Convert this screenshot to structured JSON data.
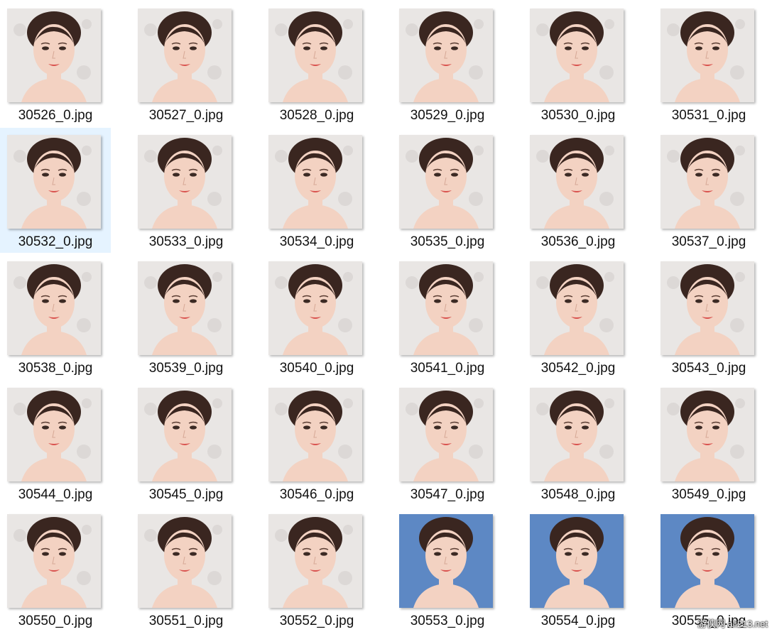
{
  "files": [
    {
      "name": "30526_0.jpg",
      "bg": "light",
      "selected": false
    },
    {
      "name": "30527_0.jpg",
      "bg": "light",
      "selected": false
    },
    {
      "name": "30528_0.jpg",
      "bg": "light",
      "selected": false
    },
    {
      "name": "30529_0.jpg",
      "bg": "light",
      "selected": false
    },
    {
      "name": "30530_0.jpg",
      "bg": "light",
      "selected": false
    },
    {
      "name": "30531_0.jpg",
      "bg": "light",
      "selected": false
    },
    {
      "name": "30532_0.jpg",
      "bg": "light",
      "selected": true
    },
    {
      "name": "30533_0.jpg",
      "bg": "light",
      "selected": false
    },
    {
      "name": "30534_0.jpg",
      "bg": "light",
      "selected": false
    },
    {
      "name": "30535_0.jpg",
      "bg": "light",
      "selected": false
    },
    {
      "name": "30536_0.jpg",
      "bg": "light",
      "selected": false
    },
    {
      "name": "30537_0.jpg",
      "bg": "light",
      "selected": false
    },
    {
      "name": "30538_0.jpg",
      "bg": "light",
      "selected": false
    },
    {
      "name": "30539_0.jpg",
      "bg": "light",
      "selected": false
    },
    {
      "name": "30540_0.jpg",
      "bg": "light",
      "selected": false
    },
    {
      "name": "30541_0.jpg",
      "bg": "light",
      "selected": false
    },
    {
      "name": "30542_0.jpg",
      "bg": "light",
      "selected": false
    },
    {
      "name": "30543_0.jpg",
      "bg": "light",
      "selected": false
    },
    {
      "name": "30544_0.jpg",
      "bg": "light",
      "selected": false
    },
    {
      "name": "30545_0.jpg",
      "bg": "light",
      "selected": false
    },
    {
      "name": "30546_0.jpg",
      "bg": "light",
      "selected": false
    },
    {
      "name": "30547_0.jpg",
      "bg": "light",
      "selected": false
    },
    {
      "name": "30548_0.jpg",
      "bg": "light",
      "selected": false
    },
    {
      "name": "30549_0.jpg",
      "bg": "light",
      "selected": false
    },
    {
      "name": "30550_0.jpg",
      "bg": "light",
      "selected": false
    },
    {
      "name": "30551_0.jpg",
      "bg": "light",
      "selected": false
    },
    {
      "name": "30552_0.jpg",
      "bg": "light",
      "selected": false
    },
    {
      "name": "30553_0.jpg",
      "bg": "blue",
      "selected": false
    },
    {
      "name": "30554_0.jpg",
      "bg": "blue",
      "selected": false
    },
    {
      "name": "30555_0.jpg",
      "bg": "blue",
      "selected": false
    }
  ],
  "watermark": "游侠网 ali213.net",
  "colors": {
    "selection": "#e5f3ff",
    "bg_light": "#e9e6e4",
    "bg_blue": "#5d88c4",
    "skin": "#f3d2c2",
    "hair": "#3a2620",
    "lips": "#d9534f"
  }
}
